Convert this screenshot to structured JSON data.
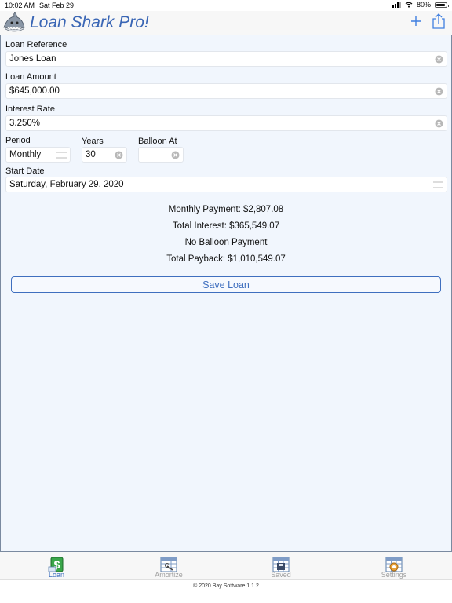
{
  "status_bar": {
    "time": "10:02 AM",
    "date": "Sat Feb 29",
    "battery": "80%"
  },
  "nav": {
    "title": "Loan Shark Pro!",
    "logo_icon": "shark-icon",
    "add_icon": "plus-icon",
    "share_icon": "share-icon"
  },
  "form": {
    "loan_reference": {
      "label": "Loan Reference",
      "value": "Jones Loan"
    },
    "loan_amount": {
      "label": "Loan Amount",
      "value": "$645,000.00"
    },
    "interest_rate": {
      "label": "Interest Rate",
      "value": "3.250%"
    },
    "period": {
      "label": "Period",
      "value": "Monthly"
    },
    "years": {
      "label": "Years",
      "value": "30"
    },
    "balloon": {
      "label": "Balloon At",
      "value": ""
    },
    "start_date": {
      "label": "Start Date",
      "value": "Saturday, February 29, 2020"
    }
  },
  "summary": {
    "monthly_payment": "Monthly Payment: $2,807.08",
    "total_interest": "Total Interest: $365,549.07",
    "balloon": "No Balloon Payment",
    "total_payback": "Total Payback: $1,010,549.07"
  },
  "save_button": "Save Loan",
  "tabs": [
    {
      "label": "Loan",
      "icon": "loan-dollar-icon",
      "active": true
    },
    {
      "label": "Amortize",
      "icon": "amortize-grid-icon",
      "active": false
    },
    {
      "label": "Saved",
      "icon": "saved-disk-icon",
      "active": false
    },
    {
      "label": "Settings",
      "icon": "settings-gear-icon",
      "active": false
    }
  ],
  "footer": "© 2020 Bay Software 1.1.2",
  "colors": {
    "accent": "#3f6fbf",
    "title": "#3a66b5",
    "form_bg": "#f1f6fd"
  }
}
